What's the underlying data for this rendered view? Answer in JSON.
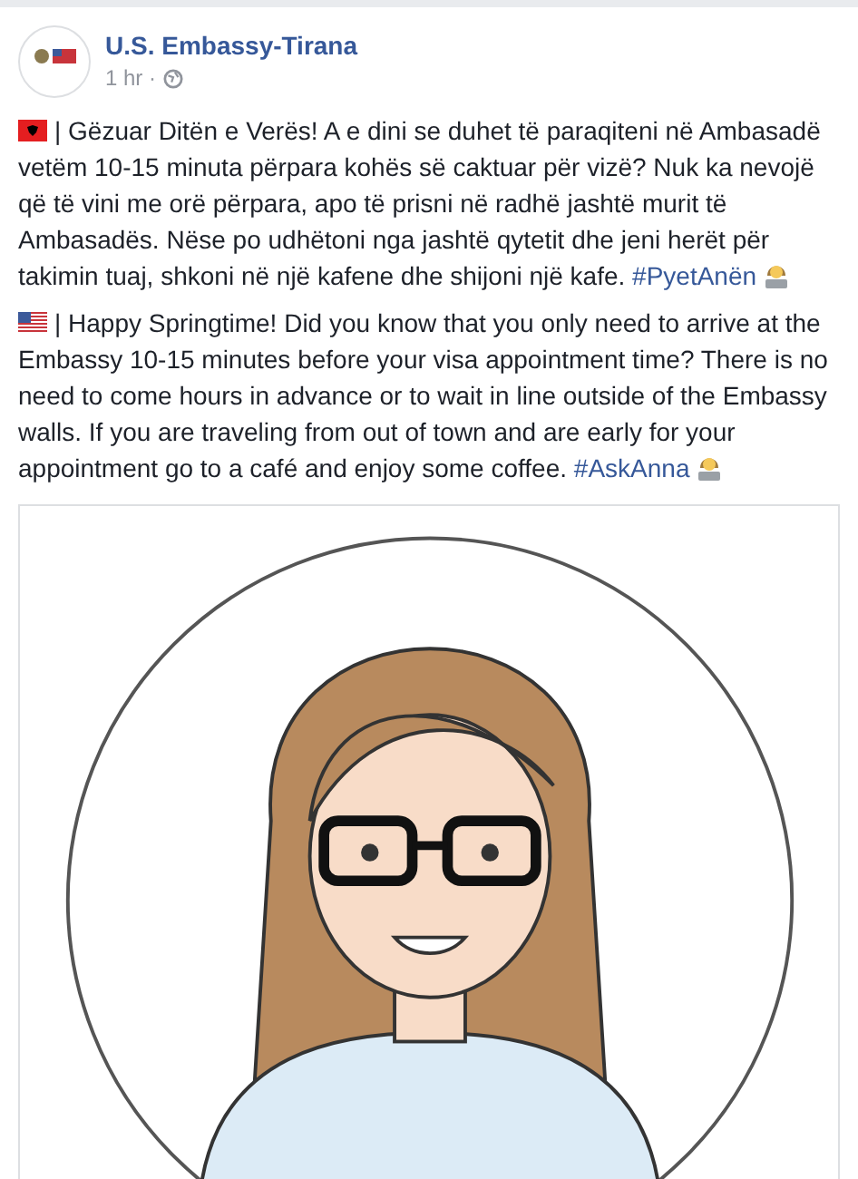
{
  "post": {
    "author": "U.S. Embassy-Tirana",
    "time": "1 hr ·",
    "paragraphs": [
      {
        "kind": "albania",
        "text": "| Gëzuar Ditën e Verës! A e dini se duhet të paraqiteni në Ambasadë vetëm 10-15 minuta përpara kohës së caktuar për vizë? Nuk ka nevojë që të vini me orë përpara, apo të prisni në radhë jashtë murit të Ambasadës. Nëse po udhëtoni nga jashtë qytetit dhe jeni herët për takimin tuaj, shkoni në një kafene dhe shijoni një kafe.",
        "hashtag": "#PyetAnën"
      },
      {
        "kind": "usa",
        "text": "| Happy Springtime! Did you know that you only need to arrive at the Embassy 10-15 minutes before your visa appointment time? There is no need to come hours in advance or to wait in line outside of the Embassy walls. If you are traveling from out of town and are early for your appointment go to a café and enjoy some coffee.",
        "hashtag": "#AskAnna"
      }
    ]
  }
}
